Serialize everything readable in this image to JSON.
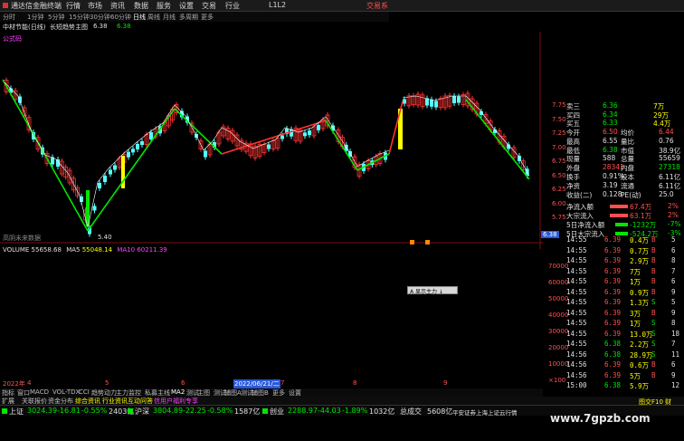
{
  "menubar": {
    "app_title": "通达信金融终端",
    "items": [
      "行情",
      "市场",
      "资讯",
      "数据",
      "服务",
      "设置",
      "交易",
      "行业",
      "L1L2"
    ],
    "trade_label": "交易系"
  },
  "toolbar": {
    "periods": [
      "分时",
      "1分钟",
      "5分钟",
      "15分钟",
      "30分钟",
      "60分钟",
      "日线",
      "周线",
      "月线",
      "多周期",
      "更多"
    ],
    "active": "日线"
  },
  "stockline": {
    "name": "中材节能(日线)",
    "indicator": "长短趋势主图",
    "value1": "6.38",
    "value2": "6.38"
  },
  "main_chart": {
    "watermark_label": "公式码",
    "bottom_note": "高阴未来数据",
    "low_label": "5.40",
    "price_axis": [
      "7.75",
      "7.50",
      "7.25",
      "7.00",
      "6.75",
      "6.50",
      "6.25",
      "6.00",
      "5.75"
    ],
    "current_price_tag": "6.38"
  },
  "volume_header": {
    "label": "VOLUME",
    "volume": "55658.68",
    "ma5_label": "MA5",
    "ma5": "55048.14",
    "ma10_label": "MA10",
    "ma10": "60211.39"
  },
  "volume_axis": [
    "70000",
    "60000",
    "50000",
    "40000",
    "30000",
    "20000",
    "10000",
    "×100"
  ],
  "date_axis": {
    "year": "2022年",
    "months": [
      "4",
      "5",
      "6",
      "7",
      "8",
      "9"
    ],
    "cursor_date": "2022/06/21/二"
  },
  "popup": {
    "label": "A 显示主力 ↓"
  },
  "quote": {
    "asks": [
      {
        "label": "卖三",
        "price": "6.36",
        "vol": "7万"
      },
      {
        "label": "买四",
        "price": "6.34",
        "vol": "29万"
      },
      {
        "label": "买五",
        "price": "6.33",
        "vol": "4.4万"
      }
    ],
    "rows": [
      {
        "l1": "今开",
        "v1": "6.50",
        "l2": "均价",
        "v2": "6.44"
      },
      {
        "l1": "最高",
        "v1": "6.55",
        "l2": "量比",
        "v2": "0.76"
      },
      {
        "l1": "最低",
        "v1": "6.38",
        "l2": "市值",
        "v2": "38.9亿"
      },
      {
        "l1": "现量",
        "v1": "588",
        "l2": "总量",
        "v2": "55659"
      },
      {
        "l1": "外盘",
        "v1": "28341",
        "l2": "内盘",
        "v2": "27318"
      },
      {
        "l1": "换手",
        "v1": "0.91%",
        "l2": "股本",
        "v2": "6.11亿"
      },
      {
        "l1": "净资",
        "v1": "3.19",
        "l2": "流通",
        "v2": "6.11亿"
      },
      {
        "l1": "收益(二)",
        "v1": "0.128",
        "l2": "PE(动)",
        "v2": "25.0"
      }
    ],
    "flows": [
      {
        "label": "净流入额",
        "value": "67.4万",
        "pct": "2%"
      },
      {
        "label": "大宗流入",
        "value": "63.1万",
        "pct": "2%"
      },
      {
        "label": "5日净流入额",
        "value": "-1232万",
        "pct": "-7%"
      },
      {
        "label": "5日大宗流入",
        "value": "-524.2万",
        "pct": "-3%"
      }
    ]
  },
  "ticks": [
    {
      "time": "14:55",
      "price": "6.39",
      "vol": "0.4万",
      "side": "B",
      "n": "5"
    },
    {
      "time": "14:55",
      "price": "6.39",
      "vol": "0.7万",
      "side": "B",
      "n": "6"
    },
    {
      "time": "14:55",
      "price": "6.39",
      "vol": "2.9万",
      "side": "B",
      "n": "8"
    },
    {
      "time": "14:55",
      "price": "6.39",
      "vol": "7万",
      "side": "B",
      "n": "7"
    },
    {
      "time": "14:55",
      "price": "6.39",
      "vol": "1万",
      "side": "B",
      "n": "6"
    },
    {
      "time": "14:55",
      "price": "6.39",
      "vol": "0.9万",
      "side": "B",
      "n": "9"
    },
    {
      "time": "14:55",
      "price": "6.39",
      "vol": "1.3万",
      "side": "S",
      "n": "5"
    },
    {
      "time": "14:55",
      "price": "6.39",
      "vol": "3万",
      "side": "B",
      "n": "9"
    },
    {
      "time": "14:55",
      "price": "6.39",
      "vol": "1万",
      "side": "S",
      "n": "8"
    },
    {
      "time": "14:55",
      "price": "6.39",
      "vol": "13.0万",
      "side": "S",
      "n": "18"
    },
    {
      "time": "14:55",
      "price": "6.38",
      "vol": "2.2万",
      "side": "S",
      "n": "7"
    },
    {
      "time": "14:56",
      "price": "6.38",
      "vol": "28.9万",
      "side": "S",
      "n": "11"
    },
    {
      "time": "14:56",
      "price": "6.39",
      "vol": "0.6万",
      "side": "B",
      "n": "6"
    },
    {
      "time": "14:56",
      "price": "6.39",
      "vol": "5万",
      "side": "B",
      "n": "9"
    },
    {
      "time": "15:00",
      "price": "6.38",
      "vol": "5.9万",
      "side": "",
      "n": "12"
    }
  ],
  "bottom_tabs": [
    "指标",
    "窗口",
    "MACD",
    "VOL-TDX",
    "CCI",
    "趋势动力",
    "主力监控",
    "私募主线",
    "MA2",
    "测试",
    "主图",
    "测试",
    "辅图A",
    "测试",
    "辅图B",
    "更多",
    "设置"
  ],
  "menu_row2": [
    {
      "text": "扩展",
      "color": "#c0c0c0"
    },
    {
      "text": "关联报价",
      "color": "#c0c0c0"
    },
    {
      "text": "资金分布",
      "color": "#c0c0c0"
    },
    {
      "text": "综合资讯",
      "color": "#ffff00"
    },
    {
      "text": "行业资讯",
      "color": "#ffff00"
    },
    {
      "text": "互动问答",
      "color": "#ffff00"
    },
    {
      "text": "信用户福利专享",
      "color": "#ff40ff"
    }
  ],
  "menu_row2_right": "图交F10 财",
  "index_bar": [
    {
      "name": "上证",
      "value": "3024.39",
      "chg": "-16.81",
      "pct": "-0.55%",
      "amt": "2403亿"
    },
    {
      "name": "沪深",
      "value": "3804.89",
      "chg": "-22.25",
      "pct": "-0.58%",
      "amt": "1587亿"
    },
    {
      "name": "创业",
      "value": "2288.97",
      "chg": "-44.03",
      "pct": "-1.89%",
      "amt": "1032亿"
    }
  ],
  "index_extra": {
    "label": "总成交",
    "value": "5608亿",
    "news": "平安证券上海上证云行情"
  },
  "site_watermark": "www.7gpzb.com",
  "colors": {
    "up": "#ff3232",
    "down": "#00e600",
    "ma_white": "#ffffff",
    "ma_yellow": "#ffff00",
    "ma_magenta": "#ff40ff",
    "cyan": "#54ffff"
  }
}
